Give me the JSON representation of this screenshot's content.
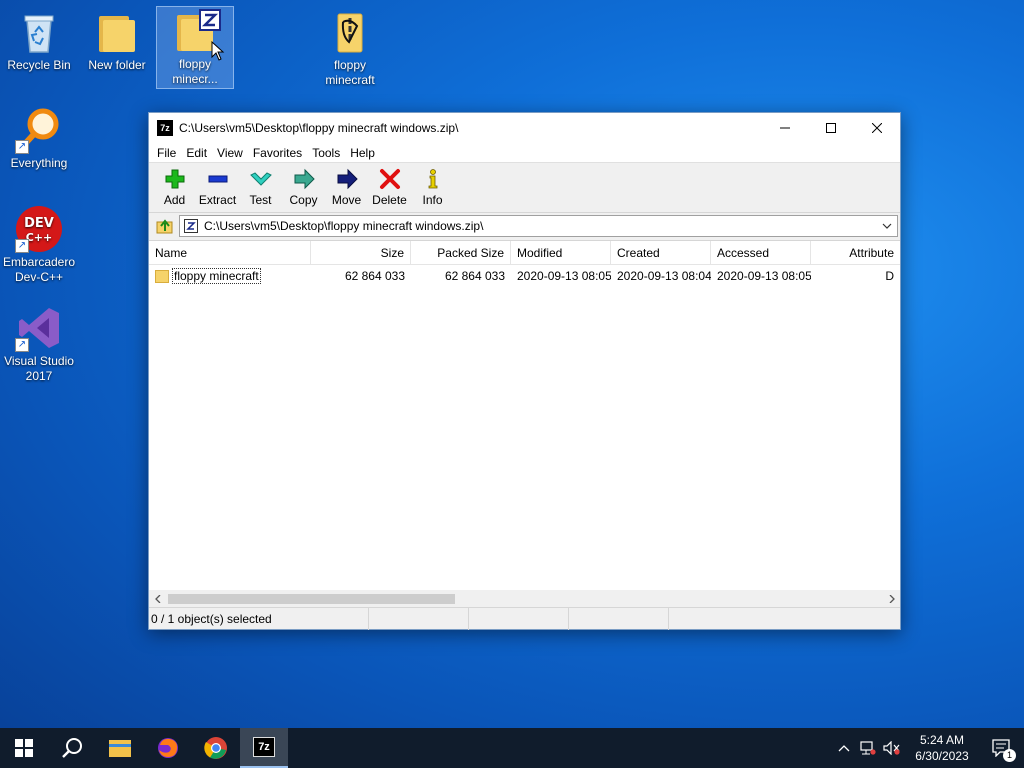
{
  "desktop": {
    "icons": [
      {
        "label": "Recycle Bin"
      },
      {
        "label": "New folder"
      },
      {
        "label": "floppy minecr..."
      },
      {
        "label": "floppy minecraft"
      },
      {
        "label": "Everything"
      },
      {
        "label": "Embarcadero Dev-C++"
      },
      {
        "label": "Visual Studio 2017"
      }
    ],
    "devcpp_logo_top": "DEV",
    "devcpp_logo_bottom": "C++"
  },
  "window": {
    "title": "C:\\Users\\vm5\\Desktop\\floppy minecraft windows.zip\\",
    "app_icon_label": "7z",
    "menu": [
      "File",
      "Edit",
      "View",
      "Favorites",
      "Tools",
      "Help"
    ],
    "toolbar": [
      "Add",
      "Extract",
      "Test",
      "Copy",
      "Move",
      "Delete",
      "Info"
    ],
    "address": "C:\\Users\\vm5\\Desktop\\floppy minecraft windows.zip\\",
    "columns": [
      "Name",
      "Size",
      "Packed Size",
      "Modified",
      "Created",
      "Accessed",
      "Attribute"
    ],
    "rows": [
      {
        "name": "floppy minecraft",
        "size": "62 864 033",
        "packed": "62 864 033",
        "modified": "2020-09-13 08:05",
        "created": "2020-09-13 08:04",
        "accessed": "2020-09-13 08:05",
        "attr": "D"
      }
    ],
    "status": "0 / 1 object(s) selected"
  },
  "taskbar": {
    "active_app_label": "7z",
    "time": "5:24 AM",
    "date": "6/30/2023",
    "notification_count": "1"
  },
  "colors": {
    "accent": "#0a64d2",
    "taskbar": "#101c2c",
    "delete_red": "#e01010",
    "add_green": "#1bb81b"
  }
}
